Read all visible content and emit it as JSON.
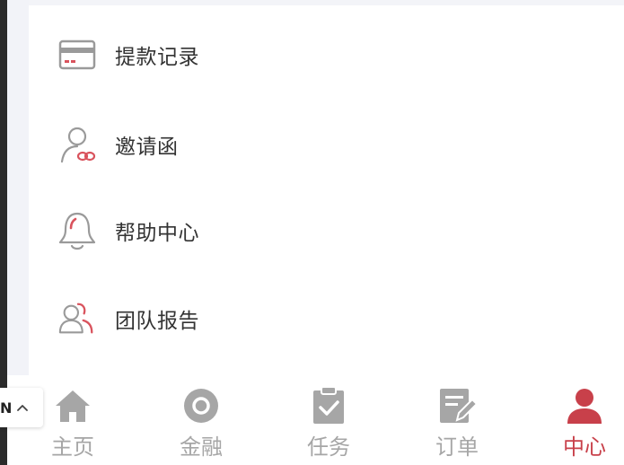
{
  "menu": {
    "items": [
      {
        "label": "提款记录",
        "icon": "card-icon"
      },
      {
        "label": "邀请函",
        "icon": "user-link-icon"
      },
      {
        "label": "帮助中心",
        "icon": "bell-icon"
      },
      {
        "label": "团队报告",
        "icon": "team-icon"
      }
    ]
  },
  "tabbar": {
    "tabs": [
      {
        "label": "主页",
        "icon": "home-icon",
        "active": false
      },
      {
        "label": "金融",
        "icon": "coin-icon",
        "active": false
      },
      {
        "label": "任务",
        "icon": "clipboard-icon",
        "active": false
      },
      {
        "label": "订单",
        "icon": "order-edit-icon",
        "active": false
      },
      {
        "label": "中心",
        "icon": "user-icon",
        "active": true
      }
    ]
  },
  "language_badge": {
    "text": "N"
  },
  "colors": {
    "accent": "#c8404a",
    "inactive": "#a6a6a6",
    "text": "#333333"
  }
}
